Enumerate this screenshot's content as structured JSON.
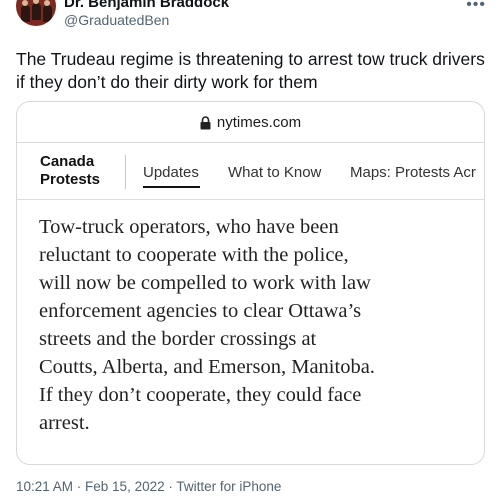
{
  "tweet": {
    "display_name": "Dr. Benjamin Braddock",
    "handle": "@GraduatedBen",
    "more_icon": "more-horizontal-icon",
    "text": "The Trudeau regime is threatening to arrest tow truck drivers if they don’t do their dirty work for them",
    "timestamp": "10:21 AM · Feb 15, 2022 · Twitter for iPhone"
  },
  "card": {
    "url": "nytimes.com",
    "url_icon": "lock-icon",
    "section_title_line1": "Canada",
    "section_title_line2": "Protests",
    "tabs": [
      "Updates",
      "What to Know",
      "Maps: Protests Acr"
    ],
    "active_tab": "Updates",
    "article_lines": [
      "Tow-truck operators, who have been",
      "reluctant to cooperate with the police,",
      "will now be compelled to work with law",
      "enforcement agencies to clear Ottawa’s",
      "streets and the border crossings at",
      "Coutts, Alberta, and Emerson, Manitoba.",
      "If they don’t cooperate, they could face",
      "arrest."
    ]
  },
  "colors": {
    "text_primary": "#0f1419",
    "text_secondary": "#536471",
    "card_border": "#d6dadd"
  }
}
